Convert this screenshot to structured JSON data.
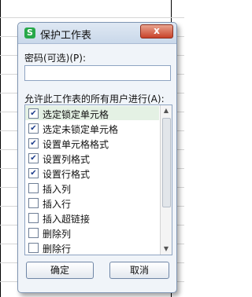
{
  "dialog": {
    "app_icon": "S",
    "title": "保护工作表",
    "close_icon": "x",
    "password_label": "密码(可选)(P):",
    "password_value": "",
    "allow_label": "允许此工作表的所有用户进行(A):",
    "items": [
      {
        "label": "选定锁定单元格",
        "checked": true,
        "selected": true
      },
      {
        "label": "选定未锁定单元格",
        "checked": true,
        "selected": false
      },
      {
        "label": "设置单元格格式",
        "checked": true,
        "selected": false
      },
      {
        "label": "设置列格式",
        "checked": true,
        "selected": false
      },
      {
        "label": "设置行格式",
        "checked": true,
        "selected": false
      },
      {
        "label": "插入列",
        "checked": false,
        "selected": false
      },
      {
        "label": "插入行",
        "checked": false,
        "selected": false
      },
      {
        "label": "插入超链接",
        "checked": false,
        "selected": false
      },
      {
        "label": "删除列",
        "checked": false,
        "selected": false
      },
      {
        "label": "删除行",
        "checked": false,
        "selected": false
      }
    ],
    "ok_label": "确定",
    "cancel_label": "取消"
  },
  "colors": {
    "dialog_bg": "#f0f4f9",
    "selected_row": "#e4f1e4",
    "close_button": "#c8422a"
  }
}
